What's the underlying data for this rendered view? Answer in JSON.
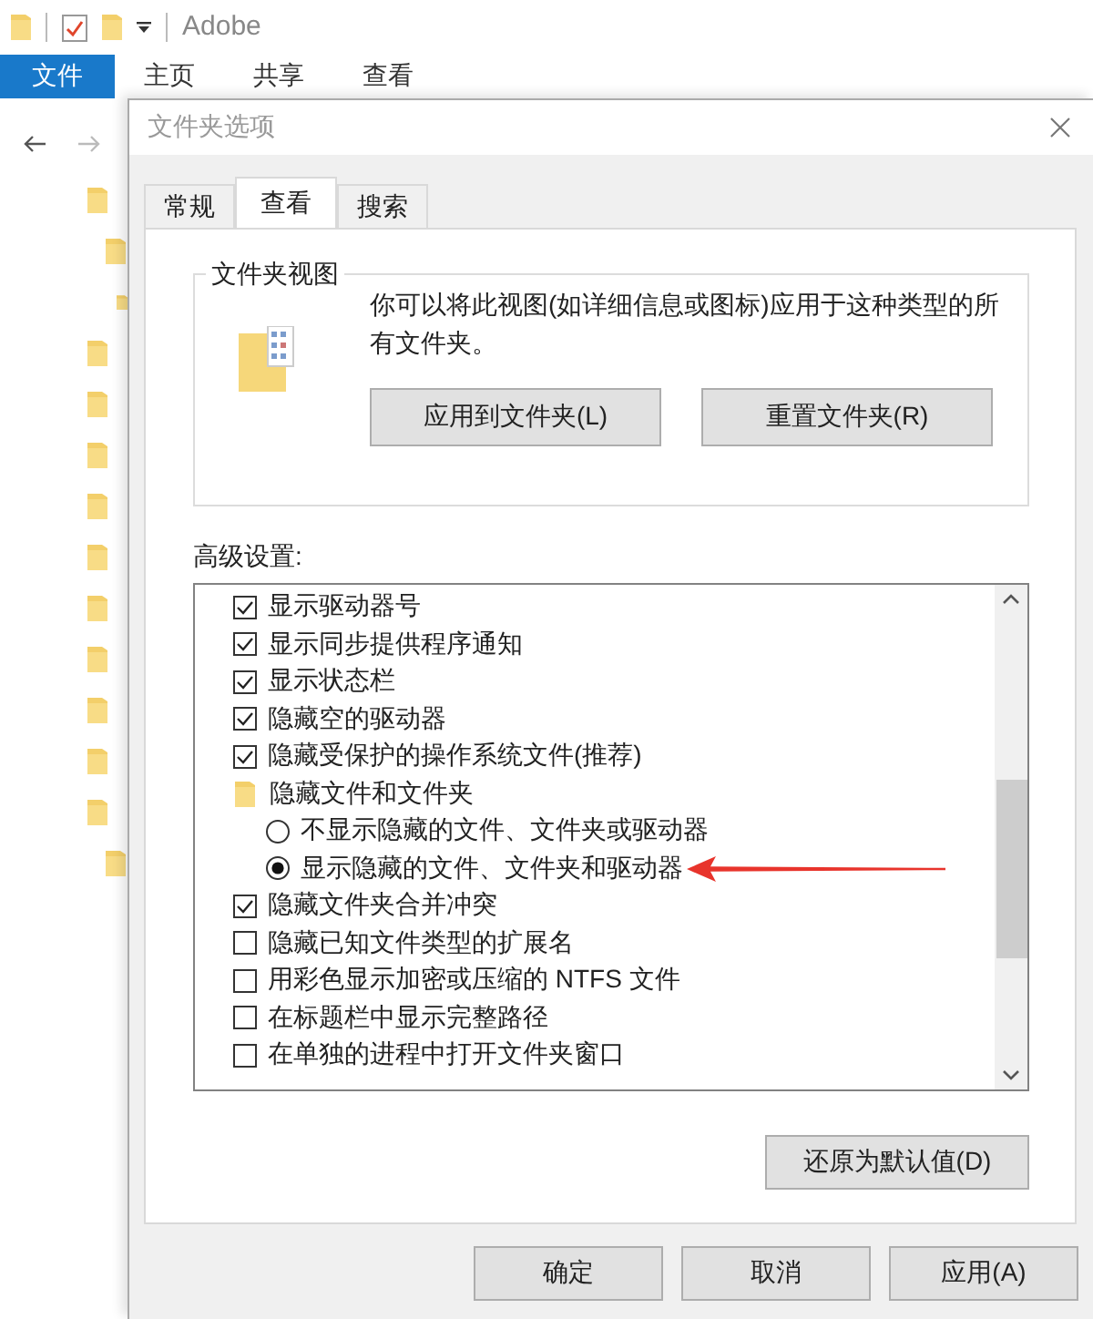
{
  "explorer": {
    "title": "Adobe",
    "ribbon_tabs": [
      {
        "label": "文件",
        "kind": "file"
      },
      {
        "label": "主页",
        "kind": "tab"
      },
      {
        "label": "共享",
        "kind": "tab"
      },
      {
        "label": "查看",
        "kind": "tab"
      }
    ]
  },
  "dialog": {
    "title": "文件夹选项",
    "tabs": [
      {
        "label": "常规",
        "selected": false
      },
      {
        "label": "查看",
        "selected": true
      },
      {
        "label": "搜索",
        "selected": false
      }
    ],
    "folder_view": {
      "heading": "文件夹视图",
      "description": "你可以将此视图(如详细信息或图标)应用于这种类型的所有文件夹。",
      "buttons": [
        "应用到文件夹(L)",
        "重置文件夹(R)"
      ]
    },
    "advanced": {
      "heading": "高级设置:",
      "items": [
        {
          "kind": "checkbox",
          "label": "显示驱动器号",
          "checked": true
        },
        {
          "kind": "checkbox",
          "label": "显示同步提供程序通知",
          "checked": true
        },
        {
          "kind": "checkbox",
          "label": "显示状态栏",
          "checked": true
        },
        {
          "kind": "checkbox",
          "label": "隐藏空的驱动器",
          "checked": true
        },
        {
          "kind": "checkbox",
          "label": "隐藏受保护的操作系统文件(推荐)",
          "checked": true
        },
        {
          "kind": "group",
          "label": "隐藏文件和文件夹"
        },
        {
          "kind": "radio",
          "label": "不显示隐藏的文件、文件夹或驱动器",
          "selected": false,
          "annotated": false
        },
        {
          "kind": "radio",
          "label": "显示隐藏的文件、文件夹和驱动器",
          "selected": true,
          "annotated": true
        },
        {
          "kind": "checkbox",
          "label": "隐藏文件夹合并冲突",
          "checked": true
        },
        {
          "kind": "checkbox",
          "label": "隐藏已知文件类型的扩展名",
          "checked": false
        },
        {
          "kind": "checkbox",
          "label": "用彩色显示加密或压缩的 NTFS 文件",
          "checked": false
        },
        {
          "kind": "checkbox",
          "label": "在标题栏中显示完整路径",
          "checked": false
        },
        {
          "kind": "checkbox",
          "label": "在单独的进程中打开文件夹窗口",
          "checked": false
        }
      ],
      "restore_button": "还原为默认值(D)"
    },
    "buttons": [
      "确定",
      "取消",
      "应用(A)"
    ]
  }
}
